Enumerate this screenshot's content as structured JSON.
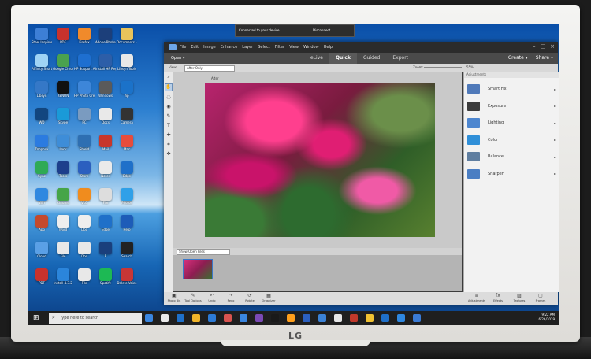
{
  "device": {
    "brand": "LG"
  },
  "desktop_icons": [
    {
      "label": "Steel Inspiron 15-7",
      "color": "#3d7fd6"
    },
    {
      "label": "PDF",
      "color": "#c8322d"
    },
    {
      "label": "Firefox",
      "color": "#f08a2b"
    },
    {
      "label": "Adobe Photosho",
      "color": "#1c3f7a"
    },
    {
      "label": "Documents - Shortcut",
      "color": "#e8c35b"
    },
    {
      "label": "Affinity Shortcut",
      "color": "#9fd3f5"
    },
    {
      "label": "Google Chrome",
      "color": "#4aa24f"
    },
    {
      "label": "HP Support Assistant",
      "color": "#1e6fd0"
    },
    {
      "label": "Install HP Registration",
      "color": "#2d5ea8"
    },
    {
      "label": "Libsyn Tools",
      "color": "#e8e8e8"
    },
    {
      "label": "Libsyn",
      "color": "#3578c7"
    },
    {
      "label": "XENON",
      "color": "#111111"
    },
    {
      "label": "HP Photo Creations",
      "color": "#3d86d9"
    },
    {
      "label": "Windows",
      "color": "#5a5a5a"
    },
    {
      "label": "hp",
      "color": "#1b72c9"
    },
    {
      "label": "WD",
      "color": "#12467f"
    },
    {
      "label": "Skype",
      "color": "#1a9ad8"
    },
    {
      "label": "PC",
      "color": "#7a9bc0"
    },
    {
      "label": "Docs",
      "color": "#e9e9e9"
    },
    {
      "label": "Camera",
      "color": "#333333"
    },
    {
      "label": "Dropbox",
      "color": "#2b7be0"
    },
    {
      "label": "Lock",
      "color": "#3e8dd8"
    },
    {
      "label": "Shield",
      "color": "#2e6fb2"
    },
    {
      "label": "Mail",
      "color": "#c8362b"
    },
    {
      "label": "Mac",
      "color": "#e74c3c"
    },
    {
      "label": "Sync",
      "color": "#2faa55"
    },
    {
      "label": "Tools",
      "color": "#1d3f8c"
    },
    {
      "label": "Store",
      "color": "#2b5fbf"
    },
    {
      "label": "Notes",
      "color": "#eaeaea"
    },
    {
      "label": "Edge",
      "color": "#1f70c9"
    },
    {
      "label": "Win",
      "color": "#2f88e0"
    },
    {
      "label": "Chrome",
      "color": "#46a548"
    },
    {
      "label": "VLC",
      "color": "#f08c1e"
    },
    {
      "label": "File",
      "color": "#dddddd"
    },
    {
      "label": "Photos",
      "color": "#2fa0e8"
    },
    {
      "label": "App",
      "color": "#c44a2d"
    },
    {
      "label": "Word",
      "color": "#eeeeee"
    },
    {
      "label": "Doc",
      "color": "#eeeeee"
    },
    {
      "label": "Edge",
      "color": "#1f70c9"
    },
    {
      "label": "Help",
      "color": "#1d5cb8"
    },
    {
      "label": "Cloud",
      "color": "#5aa0e6"
    },
    {
      "label": "File",
      "color": "#e8e8e8"
    },
    {
      "label": "Doc",
      "color": "#e8e8e8"
    },
    {
      "label": "P",
      "color": "#1a3f7c"
    },
    {
      "label": "Search",
      "color": "#222222"
    },
    {
      "label": "PDF",
      "color": "#c8322d"
    },
    {
      "label": "Install 4.3.2",
      "color": "#2b85db"
    },
    {
      "label": "File",
      "color": "#e8e8e8"
    },
    {
      "label": "Spotify",
      "color": "#1db954"
    },
    {
      "label": "Delete Voice",
      "color": "#c83636"
    }
  ],
  "connection_bar": {
    "status": "Connected to your device",
    "disconnect": "Disconnect"
  },
  "app": {
    "menu": [
      "File",
      "Edit",
      "Image",
      "Enhance",
      "Layer",
      "Select",
      "Filter",
      "View",
      "Window",
      "Help"
    ],
    "open_label": "Open",
    "modes": [
      "eLive",
      "Quick",
      "Guided",
      "Export"
    ],
    "active_mode": "Quick",
    "create_label": "Create",
    "share_label": "Share",
    "view_label": "View:",
    "view_value": "After Only",
    "zoom_label": "Zoom:",
    "zoom_value": "55%",
    "doc_label": "After",
    "bin_select": "Show Open Files",
    "panel_title": "Adjustments",
    "adjustments": [
      {
        "name": "Smart Fix",
        "color": "#4f79b9"
      },
      {
        "name": "Exposure",
        "color": "#3b3b3b"
      },
      {
        "name": "Lighting",
        "color": "#4d86cf"
      },
      {
        "name": "Color",
        "color": "#2f8fd8"
      },
      {
        "name": "Balance",
        "color": "#5f7ea0"
      },
      {
        "name": "Sharpen",
        "color": "#4a7ec3"
      }
    ],
    "bottom_left": [
      {
        "icon": "▣",
        "label": "Photo Bin"
      },
      {
        "icon": "✎",
        "label": "Tool Options"
      },
      {
        "icon": "↶",
        "label": "Undo"
      },
      {
        "icon": "↷",
        "label": "Redo"
      },
      {
        "icon": "⟳",
        "label": "Rotate"
      },
      {
        "icon": "▦",
        "label": "Organizer"
      }
    ],
    "bottom_right": [
      {
        "icon": "≡",
        "label": "Adjustments"
      },
      {
        "icon": "fx",
        "label": "Effects"
      },
      {
        "icon": "▨",
        "label": "Textures"
      },
      {
        "icon": "▢",
        "label": "Frames"
      }
    ]
  },
  "taskbar": {
    "search_placeholder": "Type here to search",
    "time": "9:22 AM",
    "date": "6/26/2019",
    "apps": [
      "#3a86e0",
      "#e9e9e9",
      "#1f70c9",
      "#f0b429",
      "#2d7bd6",
      "#d9534f",
      "#3a86e0",
      "#7b4ab5",
      "#1a1a1a",
      "#ff9f1c",
      "#2b5fbf",
      "#3b82d6",
      "#e6e6e6",
      "#c0392b",
      "#f1c232",
      "#1f70c9",
      "#2f88e0",
      "#3a7bd5"
    ]
  }
}
